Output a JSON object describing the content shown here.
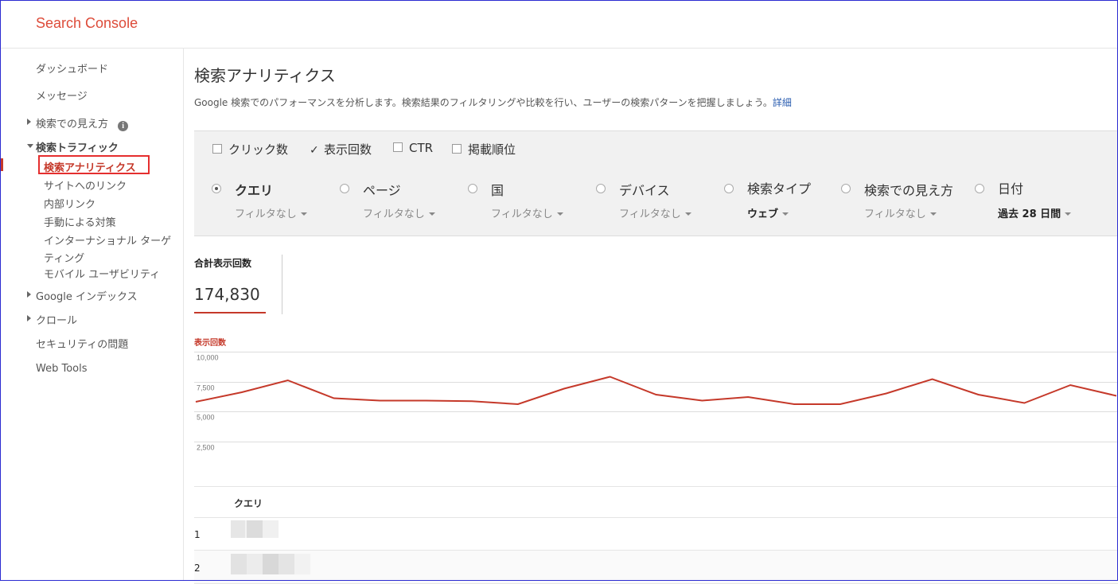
{
  "app": {
    "title": "Search Console"
  },
  "sidebar": {
    "dashboard": "ダッシュボード",
    "messages": "メッセージ",
    "search_appearance": "検索での見え方",
    "search_traffic": "検索トラフィック",
    "search_analytics": "検索アナリティクス",
    "links_to_site": "サイトへのリンク",
    "internal_links": "内部リンク",
    "manual_actions": "手動による対策",
    "international_targeting": "インターナショナル ターゲ",
    "international_targeting_2": "ティング",
    "mobile_usability": "モバイル ユーザビリティ",
    "google_index": "Google インデックス",
    "crawl": "クロール",
    "security_issues": "セキュリティの問題",
    "web_tools": "Web Tools"
  },
  "main": {
    "title": "検索アナリティクス",
    "description": "Google 検索でのパフォーマンスを分析します。検索結果のフィルタリングや比較を行い、ユーザーの検索パターンを把握しましょう。",
    "details_link": "詳細"
  },
  "metrics": {
    "clicks": {
      "label": "クリック数",
      "checked": false
    },
    "impressions": {
      "label": "表示回数",
      "checked": true
    },
    "ctr": {
      "label": "CTR",
      "checked": false
    },
    "position": {
      "label": "掲載順位",
      "checked": false
    }
  },
  "dimensions": {
    "query": {
      "label": "クエリ",
      "filter": "フィルタなし",
      "selected": true
    },
    "page": {
      "label": "ページ",
      "filter": "フィルタなし",
      "selected": false
    },
    "country": {
      "label": "国",
      "filter": "フィルタなし",
      "selected": false
    },
    "device": {
      "label": "デバイス",
      "filter": "フィルタなし",
      "selected": false
    },
    "search_type": {
      "label": "検索タイプ",
      "filter": "ウェブ",
      "selected": false
    },
    "search_appearance": {
      "label": "検索での見え方",
      "filter": "フィルタなし",
      "selected": false
    },
    "date": {
      "label": "日付",
      "filter": "過去 28 日間",
      "selected": false
    }
  },
  "totals": {
    "label": "合計表示回数",
    "value": "174,830"
  },
  "colors": {
    "accent": "#c5392a",
    "brand": "#dd4b39"
  },
  "chart_data": {
    "type": "line",
    "ylabel": "表示回数",
    "ylim": [
      0,
      10000
    ],
    "yticks": [
      "10,000",
      "7,500",
      "5,000",
      "2,500"
    ],
    "grid": true,
    "series": [
      {
        "values": [
          5800,
          6600,
          7600,
          6100,
          5900,
          5900,
          5850,
          5600,
          6900,
          7900,
          6400,
          5900,
          6200,
          5600,
          5600,
          6500,
          7700,
          6400,
          5700,
          7200,
          6300
        ]
      }
    ]
  },
  "table": {
    "header_query": "クエリ",
    "rows": [
      {
        "rank": "1"
      },
      {
        "rank": "2"
      }
    ]
  }
}
